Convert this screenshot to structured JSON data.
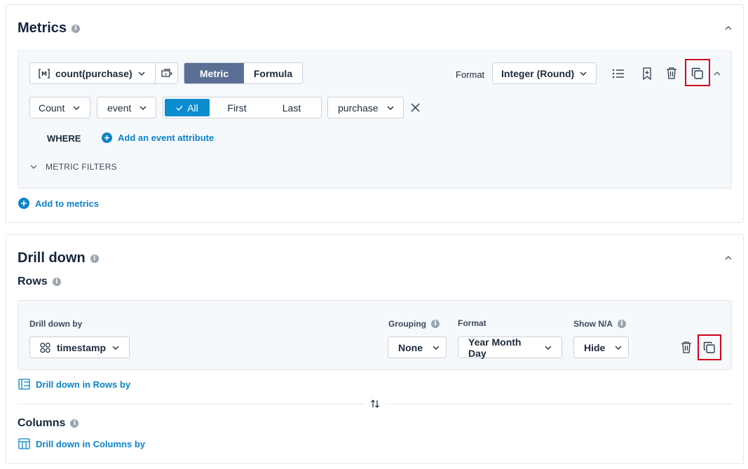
{
  "metrics": {
    "title": "Metrics",
    "metric_select": "count(purchase)",
    "tabs": [
      "Metric",
      "Formula"
    ],
    "format_label": "Format",
    "format_value": "Integer (Round)",
    "aggregation": "Count",
    "event_field": "event",
    "occurrence": [
      "All",
      "First",
      "Last"
    ],
    "event_name": "purchase",
    "where_label": "WHERE",
    "add_attribute": "Add an event attribute",
    "metric_filters": "METRIC FILTERS",
    "add_to_metrics": "Add to metrics"
  },
  "drill": {
    "title": "Drill down",
    "rows_title": "Rows",
    "drill_by_label": "Drill down by",
    "drill_by_value": "timestamp",
    "grouping_label": "Grouping",
    "grouping_value": "None",
    "format_label": "Format",
    "format_value": "Year Month Day",
    "show_na_label": "Show N/A",
    "show_na_value": "Hide",
    "drill_rows_link": "Drill down in Rows by",
    "columns_title": "Columns",
    "drill_columns_link": "Drill down in Columns by"
  },
  "colors": {
    "accent": "#0b84c6",
    "active_tab": "#5a6f93",
    "highlight": "#d0021b"
  }
}
